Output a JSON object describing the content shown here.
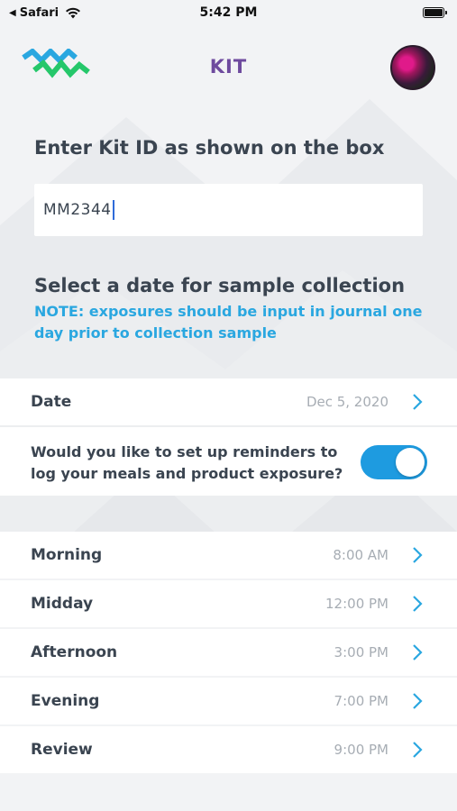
{
  "status_bar": {
    "back_app": "Safari",
    "time": "5:42 PM"
  },
  "header": {
    "title": "KIT",
    "brand_colors": [
      "#2aa7e0",
      "#25c76a"
    ]
  },
  "kit_id": {
    "label": "Enter Kit ID as shown on the box",
    "value": "MM2344"
  },
  "sample_date": {
    "label": "Select a date for sample collection",
    "note": "NOTE: exposures should be input in journal one day prior to collection sample"
  },
  "date_row": {
    "label": "Date",
    "value": "Dec 5, 2020"
  },
  "reminders": {
    "question": "Would you like to set up reminders to log your meals and product exposure?",
    "enabled": true,
    "toggle_color": "#1e9be0"
  },
  "schedule": [
    {
      "label": "Morning",
      "time": "8:00 AM"
    },
    {
      "label": "Midday",
      "time": "12:00 PM"
    },
    {
      "label": "Afternoon",
      "time": "3:00 PM"
    },
    {
      "label": "Evening",
      "time": "7:00 PM"
    },
    {
      "label": "Review",
      "time": "9:00 PM"
    }
  ],
  "colors": {
    "accent_blue": "#2aa7e0",
    "title_purple": "#6e4a9e",
    "chevron": "#2aa7e0"
  }
}
